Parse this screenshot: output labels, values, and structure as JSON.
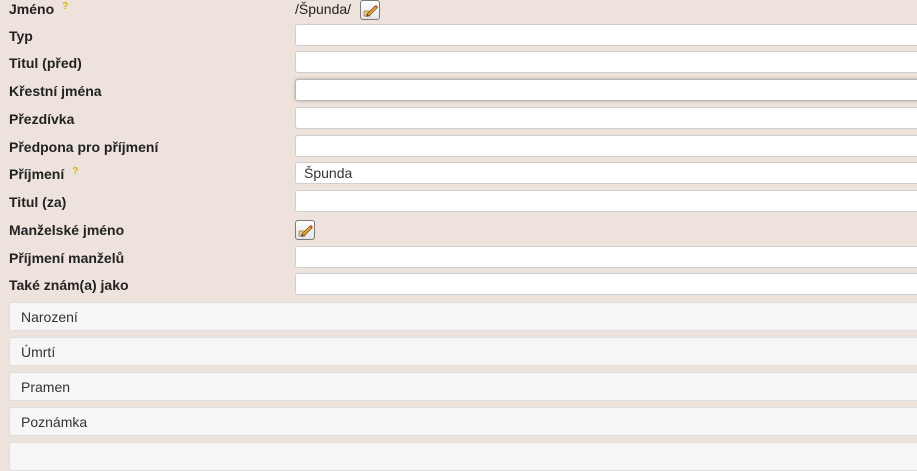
{
  "fields": {
    "jmeno": {
      "label": "Jméno",
      "help": "?",
      "value": "/Špunda/"
    },
    "typ": {
      "label": "Typ",
      "value": ""
    },
    "titul_pred": {
      "label": "Titul (před)",
      "value": ""
    },
    "krestni_jmena": {
      "label": "Křestní jména",
      "value": ""
    },
    "prezdivka": {
      "label": "Přezdívka",
      "value": ""
    },
    "predpona": {
      "label": "Předpona pro příjmení",
      "value": ""
    },
    "prijmeni": {
      "label": "Příjmení",
      "help": "?",
      "value": "Špunda"
    },
    "titul_za": {
      "label": "Titul (za)",
      "value": ""
    },
    "manzelske_jmeno": {
      "label": "Manželské jméno"
    },
    "prijmeni_manzelu": {
      "label": "Příjmení manželů",
      "value": ""
    },
    "take_znam": {
      "label": "Také znám(a) jako",
      "value": ""
    }
  },
  "sections": [
    {
      "label": "Narození"
    },
    {
      "label": "Úmrtí"
    },
    {
      "label": "Pramen"
    },
    {
      "label": "Poznámka"
    },
    {
      "label": ""
    }
  ],
  "icons": {
    "edit": "pencil-edit-icon",
    "help": "help-question-icon"
  }
}
